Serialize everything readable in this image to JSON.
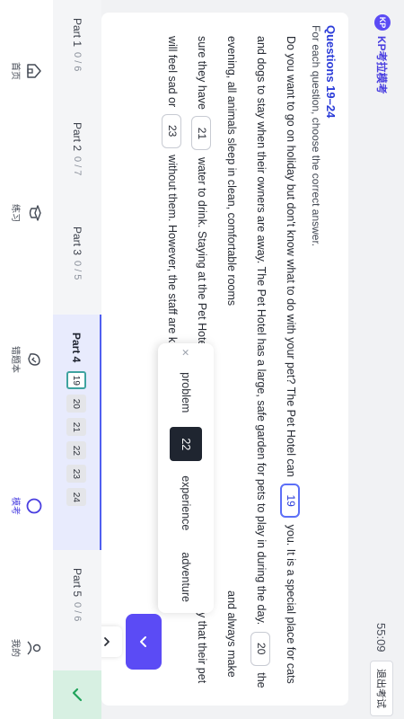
{
  "header": {
    "logo_badge": "KP",
    "logo_text": "KP考拉模考",
    "timer": "55:09",
    "exit_label": "退出考试"
  },
  "question": {
    "title": "Questions 19–24",
    "instruction": "For each question, choose the correct answer.",
    "passage": {
      "s1": "Do you want to go on holiday but don't know what to do with your pet? The Pet Hotel can",
      "gap19": "19",
      "s2": "you. It is a special place for cats and dogs to stay when their owners are away. The Pet Hotel has a large, safe garden for pets to play in during the day.",
      "gap20": "20",
      "s3": "the evening, all animals sleep in clean, comfortable rooms",
      "s4": "and always make sure they have",
      "gap21": "21",
      "s5": "water to drink. Staying at the Pet Hotel can be a good",
      "gap22": "22",
      "s6": "for a pet. Some owners worry that their pet will feel sad or",
      "gap23": "23",
      "s7": "without them. However, the staff are kind and play with the animals every da"
    },
    "options": {
      "close": "×",
      "items": [
        "problem",
        "experience",
        "adventure"
      ],
      "selected_label": "22"
    }
  },
  "parts": [
    {
      "label": "Part 1",
      "count": "0 / 6"
    },
    {
      "label": "Part 2",
      "count": "0 / 7"
    },
    {
      "label": "Part 3",
      "count": "0 / 5"
    },
    {
      "label": "Part 4",
      "numbers": [
        "19",
        "20",
        "21",
        "22",
        "23",
        "24"
      ]
    },
    {
      "label": "Part 5",
      "count": "0 / 6"
    }
  ],
  "nav": [
    {
      "label": "首页",
      "icon": "home-icon"
    },
    {
      "label": "练习",
      "icon": "practice-icon"
    },
    {
      "label": "错题本",
      "icon": "mistakes-icon"
    },
    {
      "label": "模考",
      "icon": "mock-exam-icon"
    },
    {
      "label": "我的",
      "icon": "profile-icon"
    }
  ],
  "colors": {
    "accent": "#5b4bf5",
    "link_blue": "#2a3bd8",
    "current_question_border": "#3fa3a0",
    "check_bg": "#d7f0e2"
  }
}
